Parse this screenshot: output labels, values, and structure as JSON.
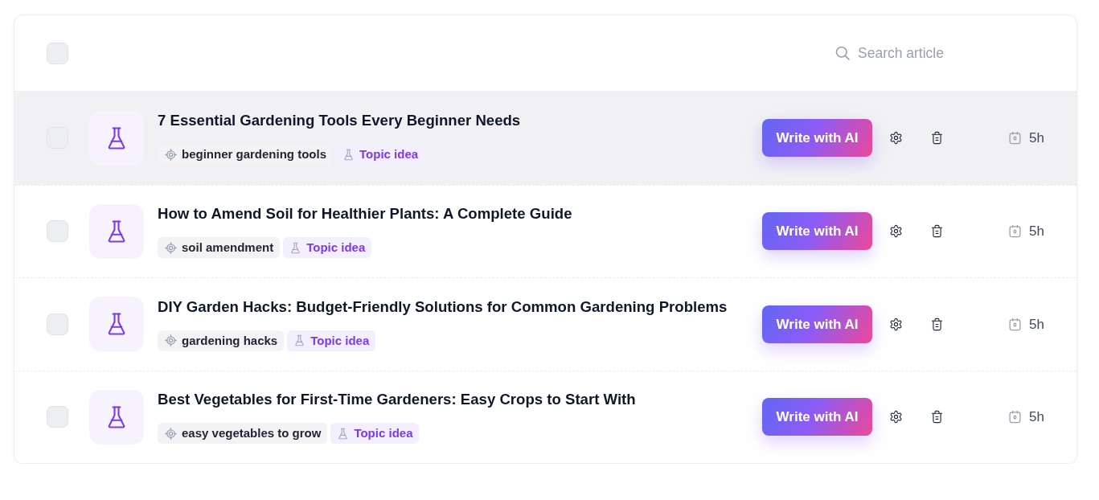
{
  "header": {
    "select_all": {
      "checked": false
    },
    "search": {
      "placeholder": "Search article"
    }
  },
  "articles": [
    {
      "checked": false,
      "highlighted": true,
      "title": "7 Essential Gardening Tools Every Beginner Needs",
      "keyword": "beginner gardening tools",
      "tag": "Topic idea",
      "action": "Write with AI",
      "age": "5h"
    },
    {
      "checked": false,
      "highlighted": false,
      "title": "How to Amend Soil for Healthier Plants: A Complete Guide",
      "keyword": "soil amendment",
      "tag": "Topic idea",
      "action": "Write with AI",
      "age": "5h"
    },
    {
      "checked": false,
      "highlighted": false,
      "title": "DIY Garden Hacks: Budget-Friendly Solutions for Common Gardening Problems",
      "keyword": "gardening hacks",
      "tag": "Topic idea",
      "action": "Write with AI",
      "age": "5h"
    },
    {
      "checked": false,
      "highlighted": false,
      "title": "Best Vegetables for First-Time Gardeners: Easy Crops to Start With",
      "keyword": "easy vegetables to grow",
      "tag": "Topic idea",
      "action": "Write with AI",
      "age": "5h"
    }
  ]
}
